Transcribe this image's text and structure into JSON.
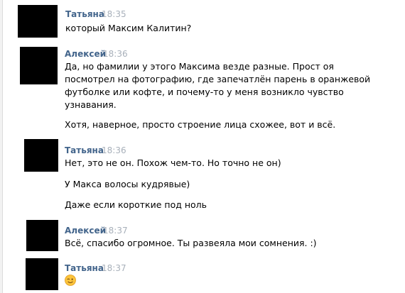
{
  "messages": [
    {
      "author": "Татьяна",
      "time": "18:35",
      "lines": [
        "который Максим Калитин?"
      ]
    },
    {
      "author": "Алексей",
      "time": "18:36",
      "lines": [
        "Да, но фамилии у этого Максима везде разные. Прост оя",
        "посмотрел на фотографию, где запечатлён парень в оранжевой",
        "футболке или кофте, и почему-то у меня возникло чувство",
        "узнавания.",
        "Хотя, наверное, просто строение лица схожее, вот и всё."
      ]
    },
    {
      "author": "Татьяна",
      "time": "18:36",
      "lines": [
        "Нет, это не он. Похож чем-то. Но точно не он)",
        "У Макса волосы кудрявые)",
        "Даже если короткие под ноль"
      ]
    },
    {
      "author": "Алексей",
      "time": "18:37",
      "lines": [
        "Всё, спасибо огромное. Ты развеяла мои сомнения. :)"
      ]
    },
    {
      "author": "Татьяна",
      "time": "18:37",
      "emoji": "wink-emoji"
    }
  ],
  "colors": {
    "author": "#42648b",
    "time": "#a8b0ba",
    "text": "#000000",
    "avatar": "#000000"
  }
}
